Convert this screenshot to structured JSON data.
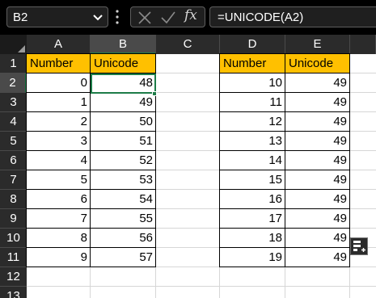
{
  "formula_bar": {
    "name_box": "B2",
    "fx_label": "fx",
    "formula": "=UNICODE(A2)"
  },
  "columns": [
    "A",
    "B",
    "C",
    "D",
    "E"
  ],
  "rows": [
    "1",
    "2",
    "3",
    "4",
    "5",
    "6",
    "7",
    "8",
    "9",
    "10",
    "11",
    "12",
    "13"
  ],
  "table1": {
    "headers": [
      "Number",
      "Unicode"
    ],
    "rows": [
      [
        "0",
        "48"
      ],
      [
        "1",
        "49"
      ],
      [
        "2",
        "50"
      ],
      [
        "3",
        "51"
      ],
      [
        "4",
        "52"
      ],
      [
        "5",
        "53"
      ],
      [
        "6",
        "54"
      ],
      [
        "7",
        "55"
      ],
      [
        "8",
        "56"
      ],
      [
        "9",
        "57"
      ]
    ]
  },
  "table2": {
    "headers": [
      "Number",
      "Unicode"
    ],
    "rows": [
      [
        "10",
        "49"
      ],
      [
        "11",
        "49"
      ],
      [
        "12",
        "49"
      ],
      [
        "13",
        "49"
      ],
      [
        "14",
        "49"
      ],
      [
        "15",
        "49"
      ],
      [
        "16",
        "49"
      ],
      [
        "17",
        "49"
      ],
      [
        "18",
        "49"
      ],
      [
        "19",
        "49"
      ]
    ]
  },
  "colors": {
    "accent": "#1d7c48",
    "header_fill": "#ffc000"
  },
  "icons": [
    "chevron-down-icon",
    "cancel-icon",
    "enter-icon",
    "quick-analysis-icon"
  ]
}
